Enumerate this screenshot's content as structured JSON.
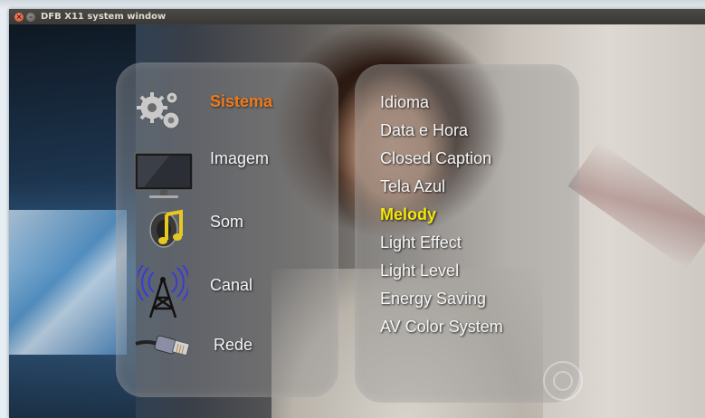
{
  "window": {
    "title": "DFB X11 system window",
    "close_glyph": "×",
    "minimize_glyph": "–"
  },
  "menu": {
    "categories": [
      {
        "label": "Sistema",
        "icon": "gears-icon",
        "active": true
      },
      {
        "label": "Imagem",
        "icon": "tv-monitor-icon",
        "active": false
      },
      {
        "label": "Som",
        "icon": "music-speaker-icon",
        "active": false
      },
      {
        "label": "Canal",
        "icon": "antenna-tower-icon",
        "active": false
      },
      {
        "label": "Rede",
        "icon": "network-cable-icon",
        "active": false
      }
    ],
    "submenu": [
      {
        "label": "Idioma",
        "selected": false
      },
      {
        "label": "Data e Hora",
        "selected": false
      },
      {
        "label": "Closed Caption",
        "selected": false
      },
      {
        "label": "Tela Azul",
        "selected": false
      },
      {
        "label": "Melody",
        "selected": true
      },
      {
        "label": "Light Effect",
        "selected": false
      },
      {
        "label": "Light Level",
        "selected": false
      },
      {
        "label": "Energy Saving",
        "selected": false
      },
      {
        "label": "AV Color System",
        "selected": false
      }
    ]
  },
  "colors": {
    "active_category": "#f07a1a",
    "selected_item": "#f4e80a",
    "menu_text": "#f6f6f6",
    "panel": "rgba(150,150,150,0.42)",
    "titlebar": "#3a3936"
  }
}
